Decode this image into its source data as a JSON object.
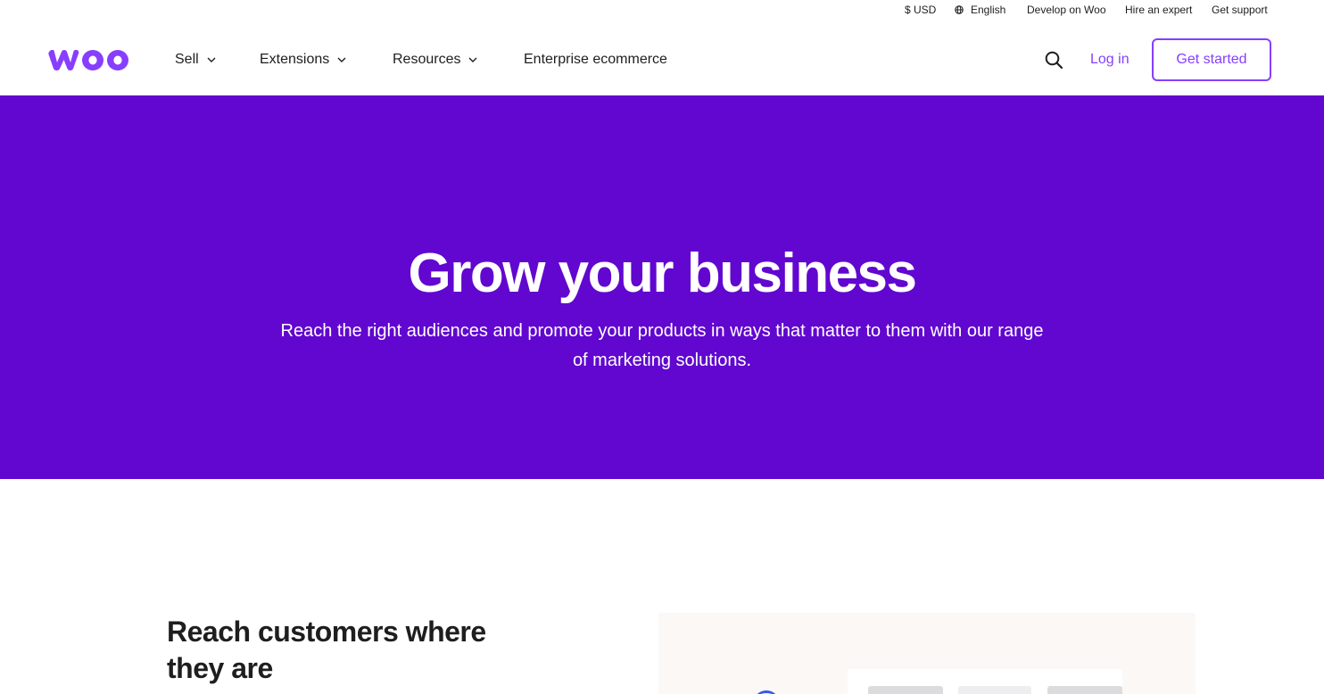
{
  "utility": {
    "currency": "$ USD",
    "language": "English",
    "develop": "Develop on Woo",
    "hire": "Hire an expert",
    "support": "Get support"
  },
  "header": {
    "logo_text": "woo",
    "nav": [
      {
        "label": "Sell",
        "has_dropdown": true
      },
      {
        "label": "Extensions",
        "has_dropdown": true
      },
      {
        "label": "Resources",
        "has_dropdown": true
      },
      {
        "label": "Enterprise ecommerce",
        "has_dropdown": false
      }
    ],
    "login": "Log in",
    "get_started": "Get started"
  },
  "hero": {
    "title": "Grow your business",
    "subtitle": "Reach the right audiences and promote your products in ways that matter to them with our range of marketing solutions."
  },
  "section": {
    "title": "Reach customers where they are"
  },
  "colors": {
    "brand_purple": "#873eff",
    "hero_bg": "#6107cf",
    "text": "#1e1e1e"
  },
  "icons": [
    "globe-icon",
    "chevron-down-icon",
    "search-icon",
    "woo-logo"
  ]
}
